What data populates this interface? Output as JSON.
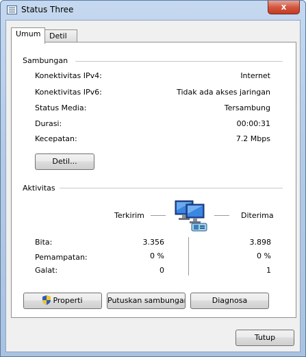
{
  "window": {
    "title": "Status Three",
    "close_glyph": "x"
  },
  "tabs": [
    {
      "label": "Umum",
      "active": true
    },
    {
      "label": "Detil",
      "active": false
    }
  ],
  "connection": {
    "heading": "Sambungan",
    "rows": [
      {
        "label": "Konektivitas IPv4:",
        "value": "Internet"
      },
      {
        "label": "Konektivitas IPv6:",
        "value": "Tidak ada akses jaringan"
      },
      {
        "label": "Status Media:",
        "value": "Tersambung"
      },
      {
        "label": "Durasi:",
        "value": "00:00:31"
      },
      {
        "label": "Kecepatan:",
        "value": "7.2 Mbps"
      }
    ],
    "details_button": "Detil..."
  },
  "activity": {
    "heading": "Aktivitas",
    "sent_label": "Terkirim",
    "received_label": "Diterima",
    "rows": [
      {
        "label": "Bita:",
        "sent": "3.356",
        "received": "3.898"
      },
      {
        "label": "Pemampatan:",
        "sent": "0 %",
        "received": "0 %"
      },
      {
        "label": "Galat:",
        "sent": "0",
        "received": "1"
      }
    ]
  },
  "buttons": {
    "properties": "Properti",
    "disconnect": "Putuskan sambungan",
    "diagnose": "Diagnosa",
    "close": "Tutup"
  },
  "icons": {
    "title": "network-status-icon",
    "network": "network-computers-icon",
    "shield": "uac-shield-icon"
  }
}
